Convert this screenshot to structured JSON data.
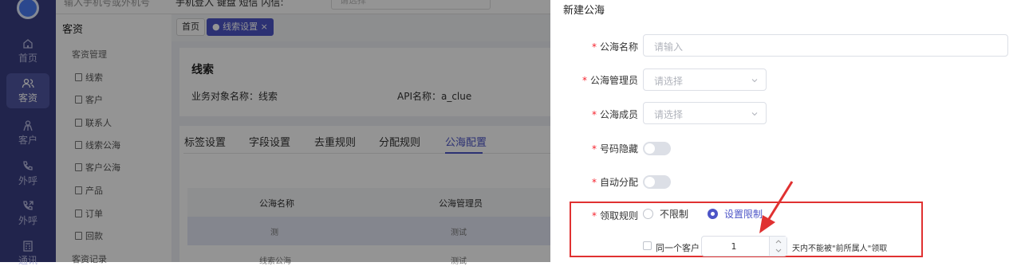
{
  "topbar": {
    "input_text": "输入手机号或外机号",
    "tools": "手机登入  键盘  短信  闪信:",
    "select_placeholder": "请选择"
  },
  "rail": [
    {
      "label": "首页",
      "icon": "home-icon"
    },
    {
      "label": "客资",
      "icon": "users-icon",
      "active": true
    },
    {
      "label": "客户",
      "icon": "person-icon"
    },
    {
      "label": "外呼",
      "icon": "phone-icon"
    },
    {
      "label": "外呼",
      "icon": "phone-out-icon"
    },
    {
      "label": "通讯",
      "icon": "calculator-icon"
    }
  ],
  "sidebar": {
    "heading": "客资",
    "group1": "客资管理",
    "items": [
      "线索",
      "客户",
      "联系人",
      "线索公海",
      "客户公海",
      "产品",
      "订单",
      "回款"
    ],
    "group2": "客资记录"
  },
  "breadcrumbs": {
    "home": "首页",
    "current": "线索设置"
  },
  "content": {
    "title": "线索",
    "object_name": "业务对象名称：线索",
    "api_name": "API名称：a_clue",
    "tabs": [
      "标签设置",
      "字段设置",
      "去重规则",
      "分配规则",
      "公海配置"
    ],
    "active_tab": "公海配置",
    "table_headers": [
      "公海名称",
      "公海管理员"
    ],
    "rows": [
      [
        "测",
        "测试"
      ],
      [
        "线索公海",
        "测试"
      ]
    ]
  },
  "drawer": {
    "title": "新建公海",
    "fields": {
      "name_label": "公海名称",
      "name_placeholder": "请输入",
      "admin_label": "公海管理员",
      "admin_placeholder": "请选择",
      "members_label": "公海成员",
      "members_placeholder": "请选择",
      "hide_label": "号码隐藏",
      "auto_label": "自动分配",
      "rule_label": "领取规则",
      "opt_unlimited": "不限制",
      "opt_limit": "设置限制",
      "same_customer": "同一个客户",
      "days_value": "1",
      "days_suffix": "天内不能被\"前所属人\"领取"
    }
  },
  "colors": {
    "accent": "#4d55c7",
    "rail": "#3a3f84",
    "highlight": "#e03131",
    "required": "#f5222d"
  }
}
